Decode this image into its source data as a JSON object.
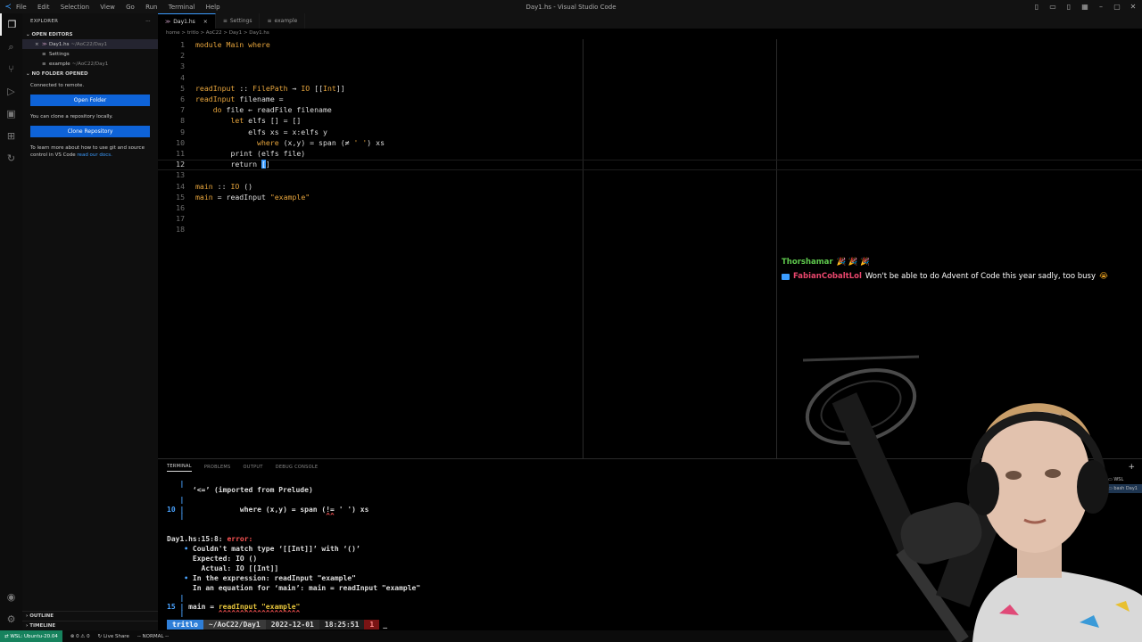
{
  "window": {
    "title": "Day1.hs - Visual Studio Code",
    "menu": [
      "File",
      "Edit",
      "Selection",
      "View",
      "Go",
      "Run",
      "Terminal",
      "Help"
    ]
  },
  "sidebar": {
    "header": "EXPLORER",
    "open_editors_label": "OPEN EDITORS",
    "open_editors": [
      {
        "name": "Day1.hs",
        "path": "~/AoC22/Day1"
      },
      {
        "name": "Settings",
        "path": ""
      },
      {
        "name": "example",
        "path": "~/AoC22/Day1"
      }
    ],
    "no_folder_label": "NO FOLDER OPENED",
    "connected_msg": "Connected to remote.",
    "open_folder_btn": "Open Folder",
    "clone_msg": "You can clone a repository locally.",
    "clone_btn": "Clone Repository",
    "learn_msg": "To learn more about how to use git and source control in VS Code",
    "learn_link": "read our docs.",
    "outline_label": "OUTLINE",
    "timeline_label": "TIMELINE"
  },
  "tabs": [
    {
      "label": "Day1.hs",
      "close": "×"
    },
    {
      "label": "Settings"
    },
    {
      "label": "example"
    }
  ],
  "breadcrumb": "home > tritlo > AoC22 > Day1 > Day1.hs",
  "editor": {
    "line_numbers": [
      "1",
      "2",
      "3",
      "4",
      "5",
      "6",
      "7",
      "8",
      "9",
      "10",
      "11",
      "12",
      "13",
      "14",
      "15",
      "16",
      "17",
      "18"
    ],
    "current_line_index": 11
  },
  "chat": {
    "user1": "Thorshamar",
    "user1_emotes": "🎉 🎉 🎉",
    "user2": "FabianCobaltLol",
    "msg2": "Won't be able to do Advent of Code this year sadly, too busy",
    "msg2_emote": "😭"
  },
  "panel": {
    "tabs": [
      "TERMINAL",
      "PROBLEMS",
      "OUTPUT",
      "DEBUG CONSOLE"
    ],
    "terminals": [
      "WSL",
      "bash Day1"
    ],
    "prompt": {
      "user": "tritlo",
      "dir": "~/AoC22/Day1",
      "date": "2022-12-01",
      "time": "18:25:51",
      "code": "1"
    }
  },
  "status": {
    "remote": "WSL: Ubuntu-20.04",
    "problems": "⊗ 0 ⚠ 0",
    "live_share": "Live Share",
    "mode": "-- NORMAL --"
  },
  "colors": {
    "accent": "#3b9cff",
    "keyword": "#e6a43c",
    "error": "#ff5555",
    "chat_user1": "#5fc94d",
    "chat_user2": "#e8466c"
  }
}
